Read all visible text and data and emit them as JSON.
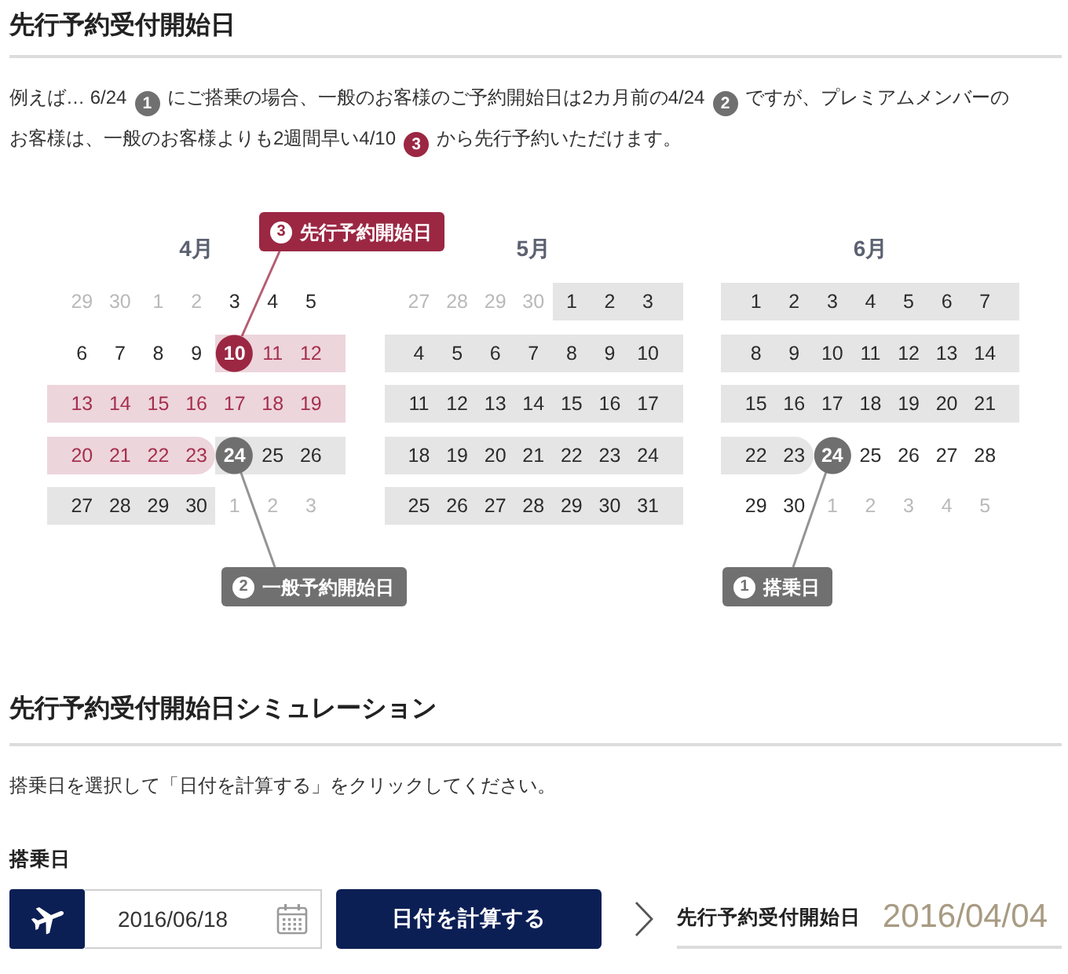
{
  "intro": {
    "title": "先行予約受付開始日",
    "description": [
      {
        "kind": "text",
        "text": "例えば… 6/24"
      },
      {
        "kind": "badge",
        "text": "1",
        "color": "#707070"
      },
      {
        "kind": "text",
        "text": "にご搭乗の場合、一般のお客様のご予約開始日は2カ月前の4/24"
      },
      {
        "kind": "badge",
        "text": "2",
        "color": "#707070"
      },
      {
        "kind": "text",
        "text": "ですが、プレミアムメンバーの"
      },
      {
        "kind": "text",
        "text": "お客様は、一般のお客様よりも2週間早い4/10"
      },
      {
        "kind": "badge",
        "text": "3",
        "color": "#9b2743"
      },
      {
        "kind": "text",
        "text": "から先行予約いただけます。"
      }
    ]
  },
  "calendar": {
    "months": [
      {
        "label": "4月",
        "weeks": [
          [
            {
              "day": "29",
              "kind": "other"
            },
            {
              "day": "30",
              "kind": "other"
            },
            {
              "day": "1",
              "kind": "other"
            },
            {
              "day": "2",
              "kind": "other"
            },
            {
              "day": "3",
              "kind": "plain"
            },
            {
              "day": "4",
              "kind": "plain"
            },
            {
              "day": "5",
              "kind": "plain"
            }
          ],
          [
            {
              "day": "6",
              "kind": "plain"
            },
            {
              "day": "7",
              "kind": "plain"
            },
            {
              "day": "8",
              "kind": "plain"
            },
            {
              "day": "9",
              "kind": "plain"
            },
            {
              "day": "10",
              "kind": "advance_start"
            },
            {
              "day": "11",
              "kind": "advance"
            },
            {
              "day": "12",
              "kind": "advance"
            }
          ],
          [
            {
              "day": "13",
              "kind": "advance"
            },
            {
              "day": "14",
              "kind": "advance"
            },
            {
              "day": "15",
              "kind": "advance"
            },
            {
              "day": "16",
              "kind": "advance"
            },
            {
              "day": "17",
              "kind": "advance"
            },
            {
              "day": "18",
              "kind": "advance"
            },
            {
              "day": "19",
              "kind": "advance"
            }
          ],
          [
            {
              "day": "20",
              "kind": "advance"
            },
            {
              "day": "21",
              "kind": "advance"
            },
            {
              "day": "22",
              "kind": "advance"
            },
            {
              "day": "23",
              "kind": "advance"
            },
            {
              "day": "24",
              "kind": "general_start"
            },
            {
              "day": "25",
              "kind": "general"
            },
            {
              "day": "26",
              "kind": "general"
            }
          ],
          [
            {
              "day": "27",
              "kind": "general"
            },
            {
              "day": "28",
              "kind": "general"
            },
            {
              "day": "29",
              "kind": "general"
            },
            {
              "day": "30",
              "kind": "general"
            },
            {
              "day": "1",
              "kind": "other"
            },
            {
              "day": "2",
              "kind": "other"
            },
            {
              "day": "3",
              "kind": "other"
            }
          ]
        ]
      },
      {
        "label": "5月",
        "weeks": [
          [
            {
              "day": "27",
              "kind": "other"
            },
            {
              "day": "28",
              "kind": "other"
            },
            {
              "day": "29",
              "kind": "other"
            },
            {
              "day": "30",
              "kind": "other"
            },
            {
              "day": "1",
              "kind": "general"
            },
            {
              "day": "2",
              "kind": "general"
            },
            {
              "day": "3",
              "kind": "general"
            }
          ],
          [
            {
              "day": "4",
              "kind": "general"
            },
            {
              "day": "5",
              "kind": "general"
            },
            {
              "day": "6",
              "kind": "general"
            },
            {
              "day": "7",
              "kind": "general"
            },
            {
              "day": "8",
              "kind": "general"
            },
            {
              "day": "9",
              "kind": "general"
            },
            {
              "day": "10",
              "kind": "general"
            }
          ],
          [
            {
              "day": "11",
              "kind": "general"
            },
            {
              "day": "12",
              "kind": "general"
            },
            {
              "day": "13",
              "kind": "general"
            },
            {
              "day": "14",
              "kind": "general"
            },
            {
              "day": "15",
              "kind": "general"
            },
            {
              "day": "16",
              "kind": "general"
            },
            {
              "day": "17",
              "kind": "general"
            }
          ],
          [
            {
              "day": "18",
              "kind": "general"
            },
            {
              "day": "19",
              "kind": "general"
            },
            {
              "day": "20",
              "kind": "general"
            },
            {
              "day": "21",
              "kind": "general"
            },
            {
              "day": "22",
              "kind": "general"
            },
            {
              "day": "23",
              "kind": "general"
            },
            {
              "day": "24",
              "kind": "general"
            }
          ],
          [
            {
              "day": "25",
              "kind": "general"
            },
            {
              "day": "26",
              "kind": "general"
            },
            {
              "day": "27",
              "kind": "general"
            },
            {
              "day": "28",
              "kind": "general"
            },
            {
              "day": "29",
              "kind": "general"
            },
            {
              "day": "30",
              "kind": "general"
            },
            {
              "day": "31",
              "kind": "general"
            }
          ]
        ]
      },
      {
        "label": "6月",
        "weeks": [
          [
            {
              "day": "1",
              "kind": "general"
            },
            {
              "day": "2",
              "kind": "general"
            },
            {
              "day": "3",
              "kind": "general"
            },
            {
              "day": "4",
              "kind": "general"
            },
            {
              "day": "5",
              "kind": "general"
            },
            {
              "day": "6",
              "kind": "general"
            },
            {
              "day": "7",
              "kind": "general"
            }
          ],
          [
            {
              "day": "8",
              "kind": "general"
            },
            {
              "day": "9",
              "kind": "general"
            },
            {
              "day": "10",
              "kind": "general"
            },
            {
              "day": "11",
              "kind": "general"
            },
            {
              "day": "12",
              "kind": "general"
            },
            {
              "day": "13",
              "kind": "general"
            },
            {
              "day": "14",
              "kind": "general"
            }
          ],
          [
            {
              "day": "15",
              "kind": "general"
            },
            {
              "day": "16",
              "kind": "general"
            },
            {
              "day": "17",
              "kind": "general"
            },
            {
              "day": "18",
              "kind": "general"
            },
            {
              "day": "19",
              "kind": "general"
            },
            {
              "day": "20",
              "kind": "general"
            },
            {
              "day": "21",
              "kind": "general"
            }
          ],
          [
            {
              "day": "22",
              "kind": "general"
            },
            {
              "day": "23",
              "kind": "general"
            },
            {
              "day": "24",
              "kind": "boarding"
            },
            {
              "day": "25",
              "kind": "plain"
            },
            {
              "day": "26",
              "kind": "plain"
            },
            {
              "day": "27",
              "kind": "plain"
            },
            {
              "day": "28",
              "kind": "plain"
            }
          ],
          [
            {
              "day": "29",
              "kind": "plain"
            },
            {
              "day": "30",
              "kind": "plain"
            },
            {
              "day": "1",
              "kind": "other"
            },
            {
              "day": "2",
              "kind": "other"
            },
            {
              "day": "3",
              "kind": "other"
            },
            {
              "day": "4",
              "kind": "other"
            },
            {
              "day": "5",
              "kind": "other"
            }
          ]
        ]
      }
    ],
    "callouts": [
      {
        "number": "3",
        "label": "先行予約開始日",
        "color": "#9b2743"
      },
      {
        "number": "2",
        "label": "一般予約開始日",
        "color": "#707070"
      },
      {
        "number": "1",
        "label": "搭乗日",
        "color": "#707070"
      }
    ]
  },
  "simulation": {
    "title": "先行予約受付開始日シミュレーション",
    "instruction": "搭乗日を選択して「日付を計算する」をクリックしてください。",
    "field_label": "搭乗日",
    "date_value": "2016/06/18",
    "button": "日付を計算する",
    "result_label": "先行予約受付開始日",
    "result_value": "2016/04/04"
  }
}
